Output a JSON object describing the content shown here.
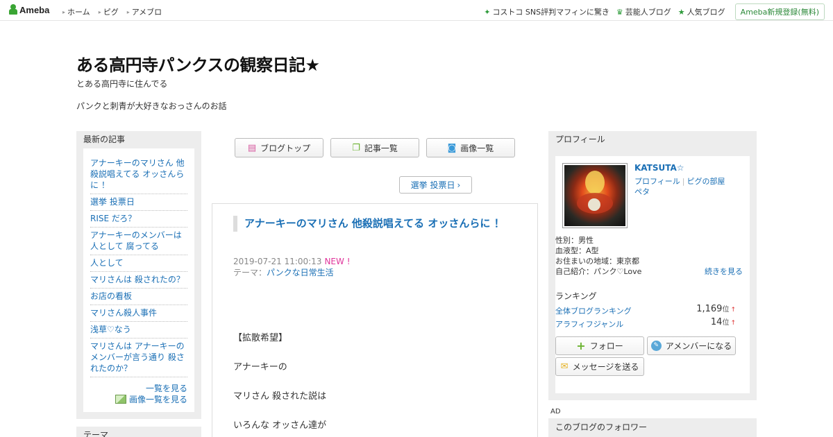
{
  "topbar": {
    "logo": "Ameba",
    "nav": [
      "ホーム",
      "ピグ",
      "アメブロ"
    ],
    "right": [
      {
        "icon": "sparkle-icon",
        "label": "コストコ SNS評判マフィンに驚き"
      },
      {
        "icon": "crown-icon",
        "label": "芸能人ブログ"
      },
      {
        "icon": "star-icon",
        "label": "人気ブログ"
      }
    ],
    "register": "Ameba新規登録(無料)"
  },
  "blog": {
    "title": "ある高円寺パンクスの観察日記★",
    "desc1": "とある高円寺に住んでる",
    "desc2": "パンクと刺青が大好きなおっさんのお話"
  },
  "left_sidebar": {
    "header": "最新の記事",
    "items": [
      "アナーキーのマリさん 他殺説唱えてる オッさんらに ！",
      "選挙 投票日",
      "RISE だろ？",
      "アナーキーのメンバーは 人として 腐ってる",
      "人として",
      "マリさんは 殺されたの？",
      "お店の看板",
      "マリさん殺人事件",
      "浅草♡なう",
      "マリさんは アナーキーの メンバーが言う通り 殺されたのか？"
    ],
    "list_link": "一覧を見る",
    "image_link": "画像一覧を見る",
    "next_header": "テーマ"
  },
  "center": {
    "buttons": [
      {
        "icon": "blog-icon",
        "label": "ブログトップ"
      },
      {
        "icon": "list-icon",
        "label": "記事一覧"
      },
      {
        "icon": "camera-icon",
        "label": "画像一覧"
      }
    ],
    "prev_entry": "選挙 投票日",
    "article": {
      "title": "アナーキーのマリさん 他殺説唱えてる オッさんらに ！",
      "date": "2019-07-21 11:00:13",
      "new": "NEW !",
      "theme_label": "テーマ：",
      "theme": "パンクな日常生活",
      "body": [
        "【拡散希望】",
        "アナーキーの",
        "マリさん 殺された説は",
        "いろんな オッさん達が"
      ]
    }
  },
  "right_sidebar": {
    "header": "プロフィール",
    "name": "KATSUTA☆",
    "link_profile": "プロフィール",
    "link_pig": "ピグの部屋",
    "link_peta": "ペタ",
    "info": [
      "性別：男性",
      "血液型：A型",
      "お住まいの地域：東京都",
      "自己紹介：パンク♡Love"
    ],
    "more": "続きを見る",
    "ranking_header": "ランキング",
    "rankings": [
      {
        "label": "全体ブログランキング",
        "value": "1,169",
        "unit": "位",
        "trend": "↑"
      },
      {
        "label": "アラフィフジャンル",
        "value": "14",
        "unit": "位",
        "trend": "↑"
      }
    ],
    "follow": "フォロー",
    "amember": "アメンバーになる",
    "message": "メッセージを送る",
    "ad": "AD",
    "followers_header": "このブログのフォロワー"
  },
  "colors": {
    "accent": "#1a6fb5",
    "ameba_green": "#3aa534",
    "new_badge": "#e0359b",
    "sidebar_bg": "#ededed"
  }
}
